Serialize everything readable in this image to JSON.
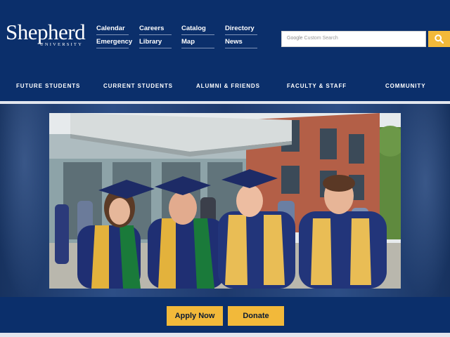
{
  "header": {
    "logo": {
      "word": "Shepherd",
      "sub": "UNIVERSITY"
    },
    "quick_links": [
      "Calendar",
      "Careers",
      "Catalog",
      "Directory",
      "Emergency",
      "Library",
      "Map",
      "News"
    ],
    "search": {
      "brand": "Google",
      "placeholder": "Custom Search"
    }
  },
  "nav": [
    "FUTURE STUDENTS",
    "CURRENT STUDENTS",
    "ALUMNI & FRIENDS",
    "FACULTY & STAFF",
    "COMMUNITY"
  ],
  "actions": {
    "apply_label": "Apply Now",
    "donate_label": "Donate"
  },
  "colors": {
    "brand_blue": "#0b2f6b",
    "accent_gold": "#f2b93a"
  }
}
